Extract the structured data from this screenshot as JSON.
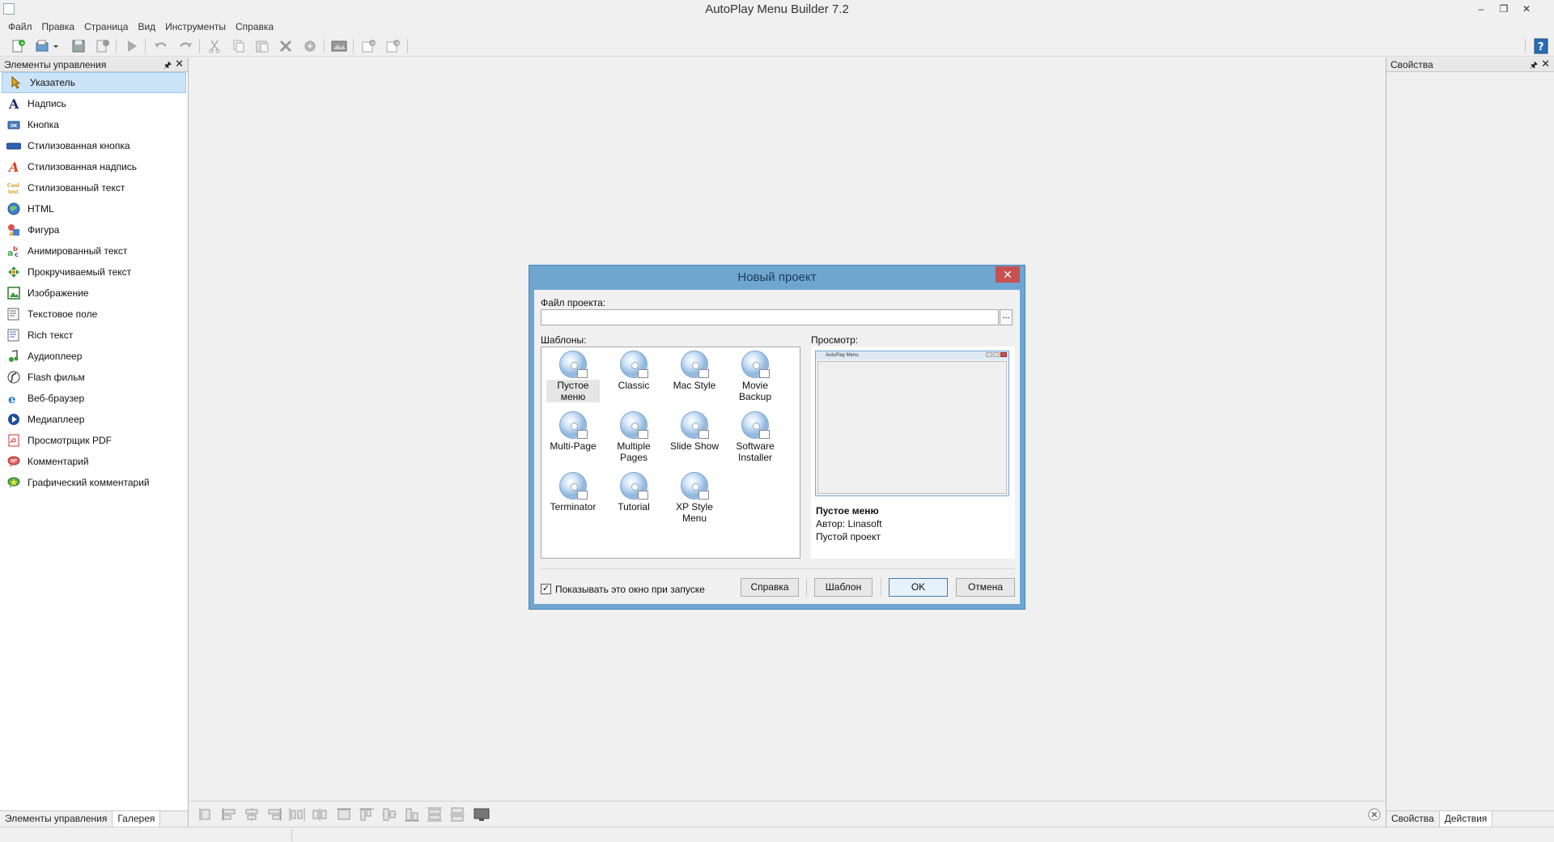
{
  "app": {
    "title": "AutoPlay Menu Builder 7.2"
  },
  "window_controls": {
    "minimize": "–",
    "restore": "❐",
    "close": "✕"
  },
  "menubar": {
    "items": [
      "Файл",
      "Правка",
      "Страница",
      "Вид",
      "Инструменты",
      "Справка"
    ]
  },
  "left_panel": {
    "title": "Элементы управления",
    "pin_symbol": "🖈",
    "close_symbol": "✕",
    "tools": [
      {
        "label": "Указатель",
        "icon": "pointer-icon"
      },
      {
        "label": "Надпись",
        "icon": "label-icon"
      },
      {
        "label": "Кнопка",
        "icon": "button-icon"
      },
      {
        "label": "Стилизованная кнопка",
        "icon": "styled-button-icon"
      },
      {
        "label": "Стилизованная надпись",
        "icon": "styled-label-icon"
      },
      {
        "label": "Стилизованный текст",
        "icon": "styled-text-icon"
      },
      {
        "label": "HTML",
        "icon": "html-globe-icon"
      },
      {
        "label": "Фигура",
        "icon": "shape-icon"
      },
      {
        "label": "Анимированный текст",
        "icon": "animated-text-icon"
      },
      {
        "label": "Прокручиваемый текст",
        "icon": "scrolling-text-icon"
      },
      {
        "label": "Изображение",
        "icon": "image-icon"
      },
      {
        "label": "Текстовое поле",
        "icon": "text-field-icon"
      },
      {
        "label": "Rich текст",
        "icon": "rich-text-icon"
      },
      {
        "label": "Аудиоплеер",
        "icon": "audio-player-icon"
      },
      {
        "label": "Flash фильм",
        "icon": "flash-icon"
      },
      {
        "label": "Веб-браузер",
        "icon": "web-browser-icon"
      },
      {
        "label": "Медиаплеер",
        "icon": "media-player-icon"
      },
      {
        "label": "Просмотрщик PDF",
        "icon": "pdf-icon"
      },
      {
        "label": "Комментарий",
        "icon": "comment-icon"
      },
      {
        "label": "Графический комментарий",
        "icon": "graphic-comment-icon"
      }
    ],
    "tabs": [
      "Элементы управления",
      "Галерея"
    ]
  },
  "right_panel": {
    "title": "Свойства",
    "pin_symbol": "🖈",
    "close_symbol": "✕",
    "tabs": [
      "Свойства",
      "Действия"
    ]
  },
  "dialog": {
    "title": "Новый проект",
    "close_symbol": "✕",
    "file_label": "Файл проекта:",
    "file_value": "",
    "browse_label": "...",
    "templates_label": "Шаблоны:",
    "preview_label": "Просмотр:",
    "templates": [
      {
        "line1": "Пустое",
        "line2": "меню"
      },
      {
        "line1": "Classic",
        "line2": ""
      },
      {
        "line1": "Mac Style",
        "line2": ""
      },
      {
        "line1": "Movie",
        "line2": "Backup"
      },
      {
        "line1": "Multi-Page",
        "line2": ""
      },
      {
        "line1": "Multiple",
        "line2": "Pages"
      },
      {
        "line1": "Slide Show",
        "line2": ""
      },
      {
        "line1": "Software",
        "line2": "Installer"
      },
      {
        "line1": "Terminator",
        "line2": ""
      },
      {
        "line1": "Tutorial",
        "line2": ""
      },
      {
        "line1": "XP Style",
        "line2": "Menu"
      }
    ],
    "preview": {
      "window_title": "AutoPlay Menu",
      "name": "Пустое меню",
      "author": "Автор:  Linasoft",
      "description": "Пустой проект"
    },
    "show_on_startup": {
      "checked": true,
      "check_mark": "✓",
      "label": "Показывать это окно при запуске"
    },
    "buttons": {
      "help": "Справка",
      "template": "Шаблон",
      "ok": "OK",
      "cancel": "Отмена"
    }
  },
  "colors": {
    "dialog_frame": "#6ea6d0",
    "selection": "#cce4f7",
    "close_red": "#c75050"
  }
}
